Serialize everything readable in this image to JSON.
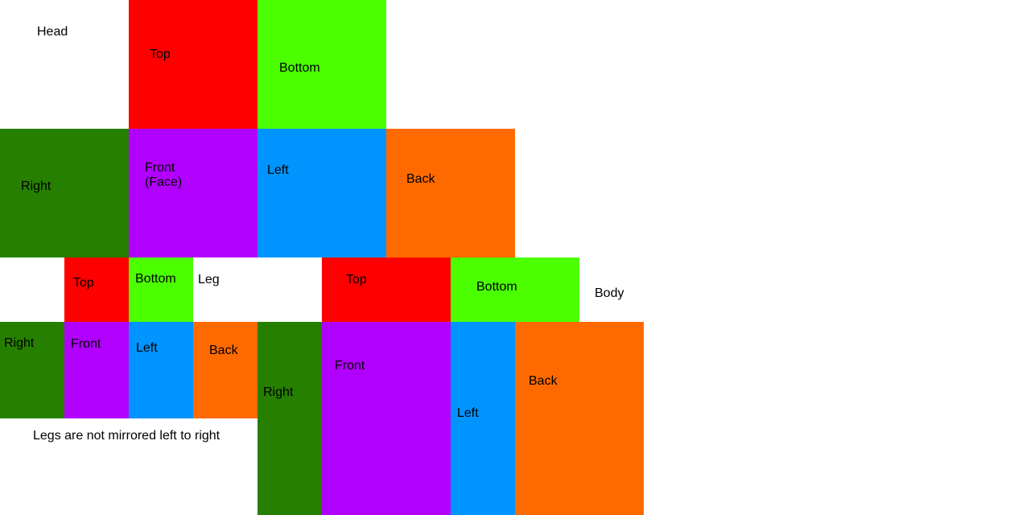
{
  "colors": {
    "top": "#ff0000",
    "bottom": "#4cff00",
    "right": "#267f00",
    "front": "#b200ff",
    "left": "#0094ff",
    "back": "#ff6a00",
    "background": "#ffffff"
  },
  "head": {
    "title": "Head",
    "top": "Top",
    "bottom": "Bottom",
    "right": "Right",
    "front": "Front\n(Face)",
    "left": "Left",
    "back": "Back"
  },
  "leg": {
    "title": "Leg",
    "top": "Top",
    "bottom": "Bottom",
    "right": "Right",
    "front": "Front",
    "left": "Left",
    "back": "Back",
    "note": "Legs are not mirrored left to right"
  },
  "body": {
    "title": "Body",
    "top": "Top",
    "bottom": "Bottom",
    "right": "Right",
    "front": "Front",
    "left": "Left",
    "back": "Back"
  }
}
